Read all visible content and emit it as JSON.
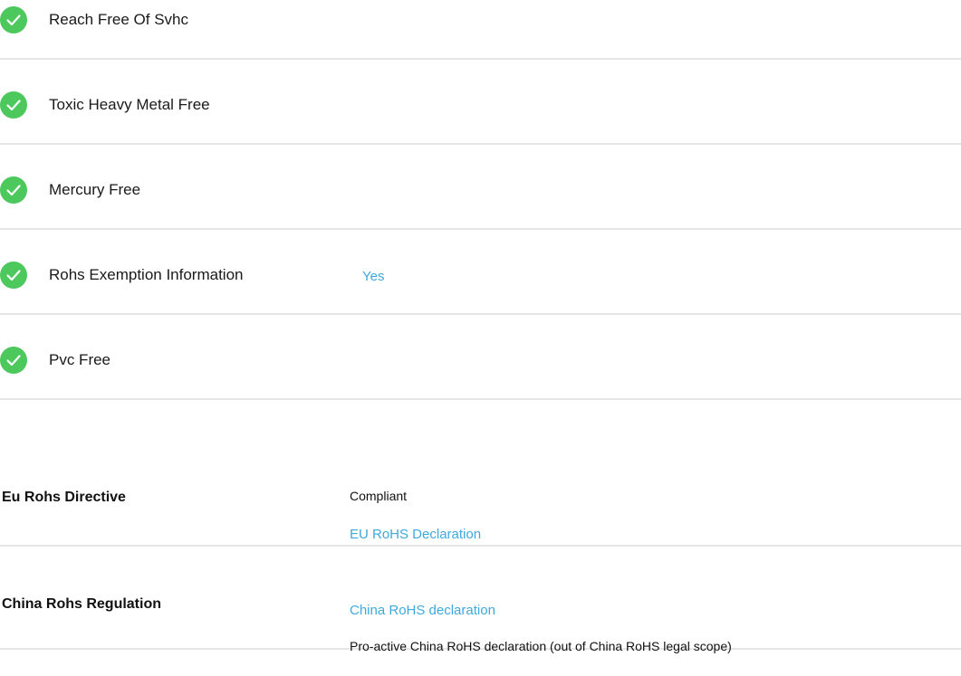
{
  "colors": {
    "check_green": "#4cc85d",
    "link_blue": "#3fa9dc",
    "divider": "#e6e6e6",
    "text": "#1a1a1a"
  },
  "checklist": {
    "items": [
      {
        "icon": "check-circle-icon",
        "label": "Reach Free Of Svhc",
        "value": ""
      },
      {
        "icon": "check-circle-icon",
        "label": "Toxic Heavy Metal Free",
        "value": ""
      },
      {
        "icon": "check-circle-icon",
        "label": "Mercury Free",
        "value": ""
      },
      {
        "icon": "check-circle-icon",
        "label": "Rohs Exemption Information",
        "value": "Yes"
      },
      {
        "icon": "check-circle-icon",
        "label": "Pvc Free",
        "value": ""
      }
    ]
  },
  "regulations": {
    "eu": {
      "title": "Eu Rohs Directive",
      "status": "Compliant",
      "link": "EU RoHS Declaration"
    },
    "china": {
      "title": "China Rohs Regulation",
      "link": "China RoHS declaration",
      "note": "Pro-active China RoHS declaration (out of China RoHS legal scope)"
    }
  }
}
